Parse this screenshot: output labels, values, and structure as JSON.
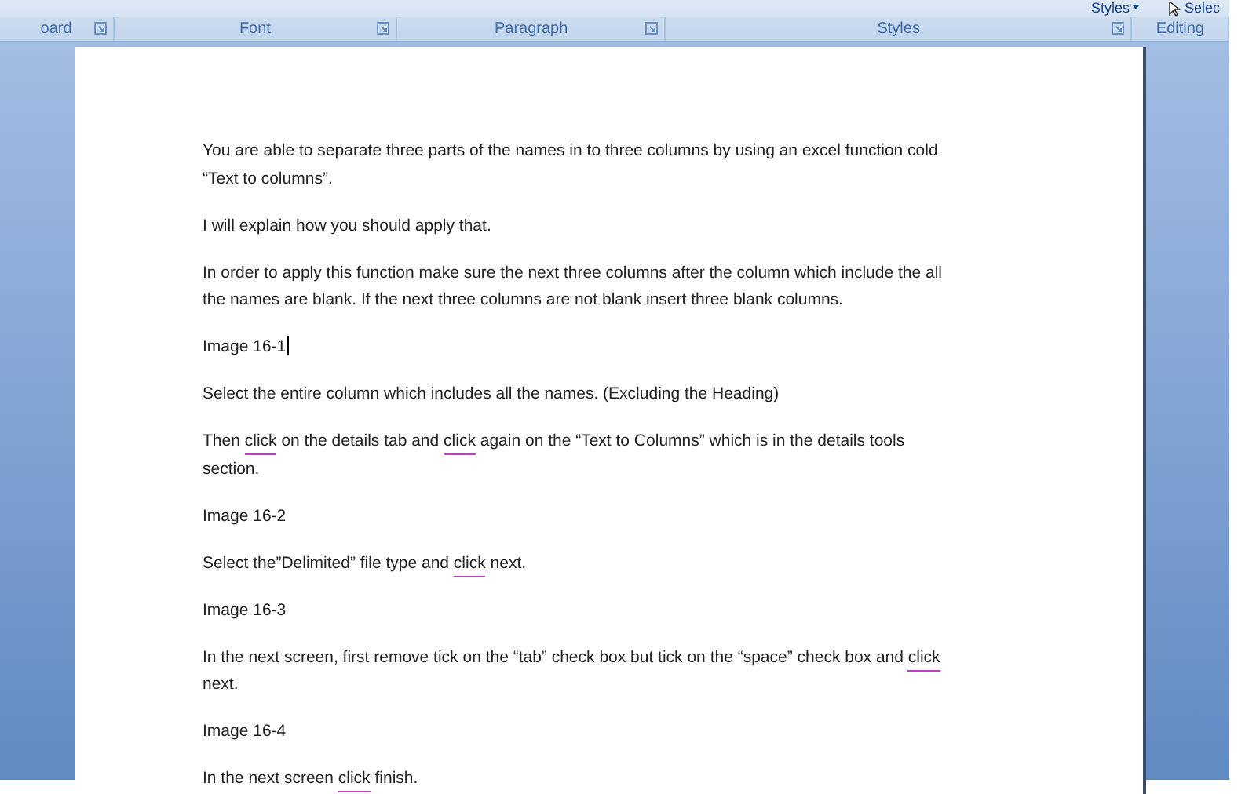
{
  "ribbon": {
    "top_controls": [
      {
        "kind": "styles",
        "label": "Styles"
      },
      {
        "kind": "select",
        "label": "Selec"
      }
    ],
    "groups": [
      {
        "label": "oard",
        "launcher": true
      },
      {
        "label": "Font",
        "launcher": true
      },
      {
        "label": "Paragraph",
        "launcher": true
      },
      {
        "label": "Styles",
        "launcher": true
      },
      {
        "label": "Editing",
        "launcher": false
      }
    ]
  },
  "document": {
    "paragraphs": [
      {
        "segments": [
          {
            "text": "You are able to separate three parts of the names in to three columns by using an excel function cold “Text to columns”.",
            "flagged": false
          }
        ],
        "cursor": false
      },
      {
        "segments": [
          {
            "text": "I will explain how you should apply that.",
            "flagged": false
          }
        ],
        "cursor": false
      },
      {
        "segments": [
          {
            "text": "In order to apply this function make sure the next three columns after the column which include the all the names are blank. If the next three columns are not blank insert three blank columns.",
            "flagged": false
          }
        ],
        "cursor": false
      },
      {
        "segments": [
          {
            "text": "Image 16-1",
            "flagged": false
          }
        ],
        "cursor": true
      },
      {
        "segments": [
          {
            "text": "Select the entire column which includes all the names. (Excluding the Heading)",
            "flagged": false
          }
        ],
        "cursor": false
      },
      {
        "segments": [
          {
            "text": "Then ",
            "flagged": false
          },
          {
            "text": "click",
            "flagged": true
          },
          {
            "text": " on the details tab and ",
            "flagged": false
          },
          {
            "text": "click",
            "flagged": true
          },
          {
            "text": " again on the “Text to Columns” which is in the details tools section.",
            "flagged": false
          }
        ],
        "cursor": false
      },
      {
        "segments": [
          {
            "text": "Image 16-2",
            "flagged": false
          }
        ],
        "cursor": false
      },
      {
        "segments": [
          {
            "text": "Select the”Delimited” file type and ",
            "flagged": false
          },
          {
            "text": "click",
            "flagged": true
          },
          {
            "text": " next.",
            "flagged": false
          }
        ],
        "cursor": false
      },
      {
        "segments": [
          {
            "text": "Image 16-3",
            "flagged": false
          }
        ],
        "cursor": false
      },
      {
        "segments": [
          {
            "text": "In the next screen, first remove tick on the “tab” check box but tick on the “space” check box and ",
            "flagged": false
          },
          {
            "text": "click",
            "flagged": true
          },
          {
            "text": " next.",
            "flagged": false
          }
        ],
        "cursor": false
      },
      {
        "segments": [
          {
            "text": "Image 16-4",
            "flagged": false
          }
        ],
        "cursor": false
      },
      {
        "segments": [
          {
            "text": "In the next screen ",
            "flagged": false
          },
          {
            "text": "click",
            "flagged": true
          },
          {
            "text": " finish.",
            "flagged": false
          }
        ],
        "cursor": false
      }
    ]
  }
}
